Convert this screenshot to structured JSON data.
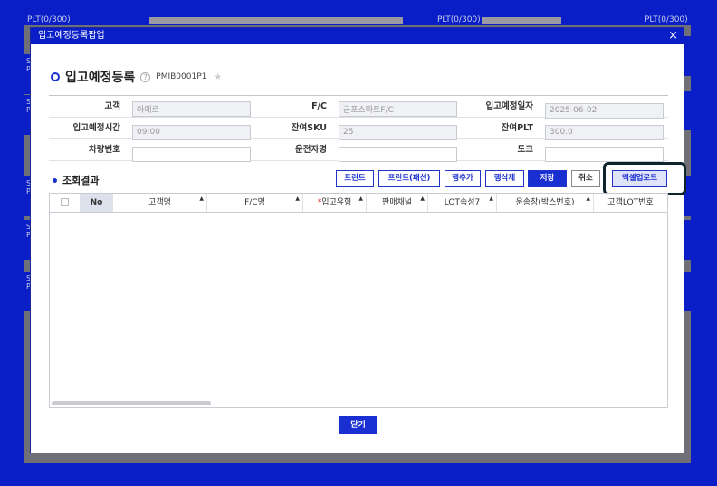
{
  "background": {
    "plt_labels": [
      "PLT(0/300)",
      "PLT(0/300)",
      "PLT(0/300)"
    ],
    "side_labels": [
      "S P",
      "S P",
      "S P",
      "S P",
      "S P"
    ],
    "side_labels_top": [
      "S",
      "P"
    ]
  },
  "modal": {
    "title": "입고예정등록팝업",
    "close_symbol": "×",
    "heading": "입고예정등록",
    "help_symbol": "?",
    "screen_id": "PMIB0001P1",
    "star_symbol": "★"
  },
  "form": {
    "row1": {
      "label_customer": "고객",
      "customer": "아에르",
      "label_fc": "F/C",
      "fc": "군포스마트F/C",
      "label_date": "입고예정일자",
      "date": "2025-06-02"
    },
    "row2": {
      "label_time": "입고예정시간",
      "time": "09:00",
      "label_sku": "잔여SKU",
      "sku": "25",
      "label_plt": "잔여PLT",
      "plt": "300.0"
    },
    "row3": {
      "label_vehicle": "차량번호",
      "vehicle": "",
      "label_driver": "운전자명",
      "driver": "",
      "label_dock": "도크",
      "dock": ""
    }
  },
  "results": {
    "title": "조회결과",
    "buttons": {
      "print": "프린트",
      "print_fashion": "프린트(패션)",
      "add_row": "행추가",
      "delete_row": "행삭제",
      "save": "저장",
      "cancel": "취소",
      "excel_upload": "엑셀업로드"
    },
    "columns": [
      "No",
      "고객명",
      "F/C명",
      "입고유형",
      "판매채널",
      "LOT속성7",
      "운송장(박스번호)",
      "고객LOT번호"
    ],
    "required_mark": "*",
    "sort_symbol": "▲"
  },
  "footer": {
    "close_label": "닫기"
  },
  "colors": {
    "accent": "#1a2fd1",
    "header_bg": "#0a1ec8",
    "required": "#e0101a"
  }
}
